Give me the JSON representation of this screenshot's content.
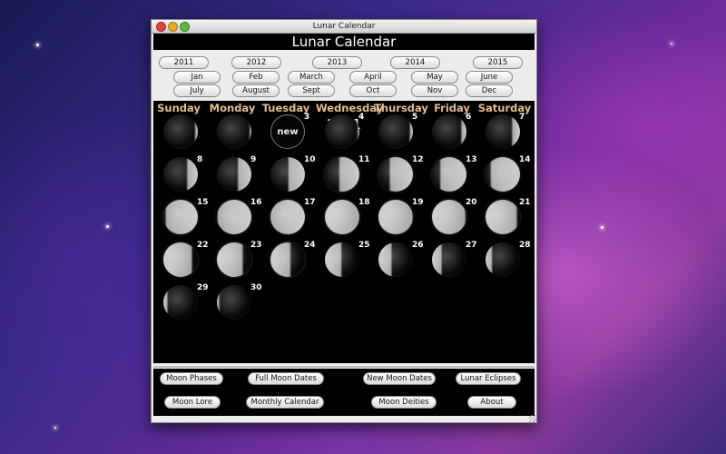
{
  "window": {
    "title": "Lunar Calendar"
  },
  "app": {
    "header": "Lunar Calendar"
  },
  "years": [
    "2011",
    "2012",
    "2013",
    "2014",
    "2015"
  ],
  "months": [
    "Jan",
    "Feb",
    "March",
    "April",
    "May",
    "June",
    "July",
    "August",
    "Sept",
    "Oct",
    "Nov",
    "Dec"
  ],
  "weekdays": [
    "Sunday",
    "Monday",
    "Tuesday",
    "Wednesday",
    "Thursday",
    "Friday",
    "Saturday"
  ],
  "calendar": {
    "year": "2011",
    "month": "April",
    "new_label": "new",
    "days": [
      {
        "day": "",
        "illum": 0.05,
        "waxing": true
      },
      {
        "day": "",
        "illum": 0.02,
        "waxing": true
      },
      {
        "day": "3",
        "illum": 0.0,
        "waxing": true,
        "new": true
      },
      {
        "day": "4",
        "illum": 0.02,
        "waxing": true
      },
      {
        "day": "5",
        "illum": 0.06,
        "waxing": true
      },
      {
        "day": "6",
        "illum": 0.12,
        "waxing": true
      },
      {
        "day": "7",
        "illum": 0.2,
        "waxing": true
      },
      {
        "day": "8",
        "illum": 0.28,
        "waxing": true
      },
      {
        "day": "9",
        "illum": 0.36,
        "waxing": true
      },
      {
        "day": "10",
        "illum": 0.45,
        "waxing": true
      },
      {
        "day": "11",
        "illum": 0.55,
        "waxing": true
      },
      {
        "day": "12",
        "illum": 0.64,
        "waxing": true
      },
      {
        "day": "13",
        "illum": 0.73,
        "waxing": true
      },
      {
        "day": "14",
        "illum": 0.82,
        "waxing": true
      },
      {
        "day": "15",
        "illum": 0.9,
        "waxing": true
      },
      {
        "day": "16",
        "illum": 0.96,
        "waxing": true
      },
      {
        "day": "17",
        "illum": 1.0,
        "waxing": true
      },
      {
        "day": "18",
        "illum": 1.0,
        "waxing": false
      },
      {
        "day": "19",
        "illum": 0.98,
        "waxing": false
      },
      {
        "day": "20",
        "illum": 0.94,
        "waxing": false
      },
      {
        "day": "21",
        "illum": 0.88,
        "waxing": false
      },
      {
        "day": "22",
        "illum": 0.8,
        "waxing": false
      },
      {
        "day": "23",
        "illum": 0.72,
        "waxing": false
      },
      {
        "day": "24",
        "illum": 0.55,
        "waxing": false
      },
      {
        "day": "25",
        "illum": 0.45,
        "waxing": false
      },
      {
        "day": "26",
        "illum": 0.35,
        "waxing": false
      },
      {
        "day": "27",
        "illum": 0.25,
        "waxing": false
      },
      {
        "day": "28",
        "illum": 0.16,
        "waxing": false
      },
      {
        "day": "29",
        "illum": 0.09,
        "waxing": false
      },
      {
        "day": "30",
        "illum": 0.04,
        "waxing": false
      }
    ]
  },
  "bottom_buttons": [
    "Moon Phases",
    "Full Moon Dates",
    "New Moon Dates",
    "Lunar Eclipses",
    "Moon Lore",
    "Monthly Calendar",
    "Moon Deities",
    "About"
  ],
  "colors": {
    "weekday_text": "#e6bb8e",
    "panel_bg": "#000000"
  }
}
